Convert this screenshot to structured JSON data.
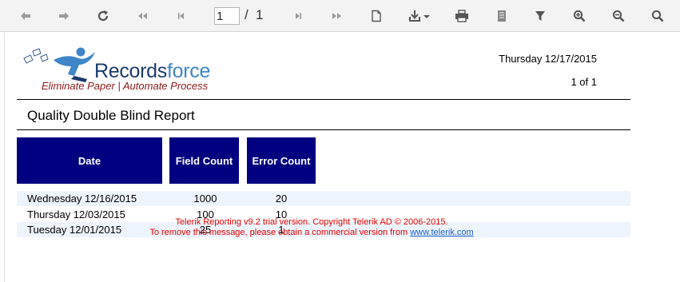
{
  "toolbar": {
    "page_current": "1",
    "page_separator": "/",
    "page_total": "1",
    "buttons": [
      "back-icon",
      "forward-icon",
      "refresh-icon",
      "first-page-icon",
      "previous-page-icon",
      "next-page-icon",
      "last-page-icon",
      "print-preview-icon",
      "export-icon",
      "print-icon",
      "document-map-icon",
      "parameters-icon",
      "zoom-in-icon",
      "zoom-out-icon",
      "search-icon"
    ]
  },
  "logo": {
    "word_records": "Records",
    "word_force": "force",
    "tagline": "Eliminate Paper | Automate Process",
    "colors": {
      "primary": "#1c3b6e",
      "accent": "#3f86c8",
      "tagline": "#8b1a1a"
    }
  },
  "header": {
    "date": "Thursday 12/17/2015",
    "page_info": "1 of 1"
  },
  "report": {
    "title": "Quality Double Blind Report",
    "columns": [
      "Date",
      "Field Count",
      "Error Count"
    ],
    "rows": [
      {
        "date": "Wednesday 12/16/2015",
        "field_count": "1000",
        "error_count": "20"
      },
      {
        "date": "Thursday 12/03/2015",
        "field_count": "100",
        "error_count": "10"
      },
      {
        "date": "Tuesday 12/01/2015",
        "field_count": "25",
        "error_count": "1"
      }
    ],
    "header_color": "#000080",
    "alt_row_color": "#eef4fc"
  },
  "watermark": {
    "line1": "Telerik Reporting v9.2 trial version. Copyright Telerik AD © 2006-2015.",
    "line2": "To remove this message, please obtain a commercial version from",
    "link": "www.telerik.com"
  }
}
